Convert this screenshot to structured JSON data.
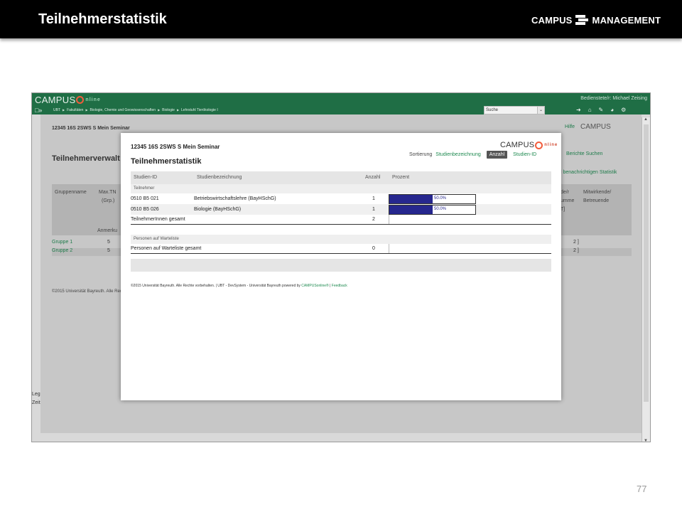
{
  "slide": {
    "title": "Teilnehmerstatistik",
    "logo_left": "CAMPUS",
    "logo_right": "MANAGEMENT",
    "page_number": "77"
  },
  "app": {
    "logo": {
      "campus": "CAMPUS",
      "online": "nline"
    },
    "user_label": "Bedienstete/r: Michael Zeising",
    "breadcrumb": [
      "UBT",
      "Fakultäten",
      "Biologie, Chemie und Geowissenschaften",
      "Biologie",
      "Lehrstuhl Tierökologie I"
    ],
    "search": {
      "value": "Suche"
    },
    "top_icons": [
      "logout-icon",
      "home-icon",
      "edit-icon",
      "dashboard-icon",
      "tools-icon"
    ]
  },
  "background_page": {
    "seminar": "12345 16S 2SWS S Mein Seminar",
    "hilfe": "Hilfe",
    "logo": {
      "campus": "CAMPUS",
      "online": "nline"
    },
    "title": "Teilnehmerverwalt",
    "links1": "Berichte  Suchen",
    "links2": "l benachrichtigen  Statistik",
    "headers": {
      "gruppenname": "Gruppenname",
      "max_tn": "Max.TN",
      "grp": "(Grp.)",
      "anmerk": "Anmerku",
      "summe1": "de/r",
      "summe2": "umme",
      "summe3": "T]",
      "mitwirkende1": "Mitwirkende/",
      "mitwirkende2": "Betreuende"
    },
    "rows": [
      {
        "group": "Gruppe 1",
        "max": "5",
        "rest": "2 ]"
      },
      {
        "group": "Gruppe 2",
        "max": "5",
        "rest": "2 ]"
      }
    ],
    "footer": "©2015 Universität Bayreuth. Alle Rechte vo",
    "legend": "Leg",
    "zeit": "Zeit"
  },
  "popup": {
    "seminar": "12345 16S 2SWS S Mein Seminar",
    "title": "Teilnehmerstatistik",
    "logo": {
      "campus": "CAMPUS",
      "online": "nline"
    },
    "sort": {
      "label": "Sortierung",
      "by_name": "Studienbezeichnung",
      "by_count": "Anzahl",
      "by_id": "Studien-ID"
    },
    "columns": {
      "id": "Studien-ID",
      "name": "Studienbezeichnung",
      "count": "Anzahl",
      "percent": "Prozent"
    },
    "section_participants": "Teilnehmer",
    "rows": [
      {
        "id": "0510 B5 021",
        "name": "Betriebswirtschaftslehre (BayHSchG)",
        "count": "1",
        "percent": "50.0%",
        "fraction": 0.5
      },
      {
        "id": "0510 B5 026",
        "name": "Biologie (BayHSchG)",
        "count": "1",
        "percent": "50.0%",
        "fraction": 0.5
      }
    ],
    "total_participants": {
      "label": "TeilnehmerInnen gesamt",
      "count": "2"
    },
    "section_waitlist": "Personen auf Warteliste",
    "total_waitlist": {
      "label": "Personen auf Warteliste gesamt",
      "count": "0"
    },
    "footer": {
      "text": "©2015 Universität Bayreuth. Alle Rechte vorbehalten. | UBT - DevSystem - Universität Bayreuth powered by ",
      "powered": "CAMPUSonline®",
      "sep": " | ",
      "feedback": "Feedback"
    }
  }
}
